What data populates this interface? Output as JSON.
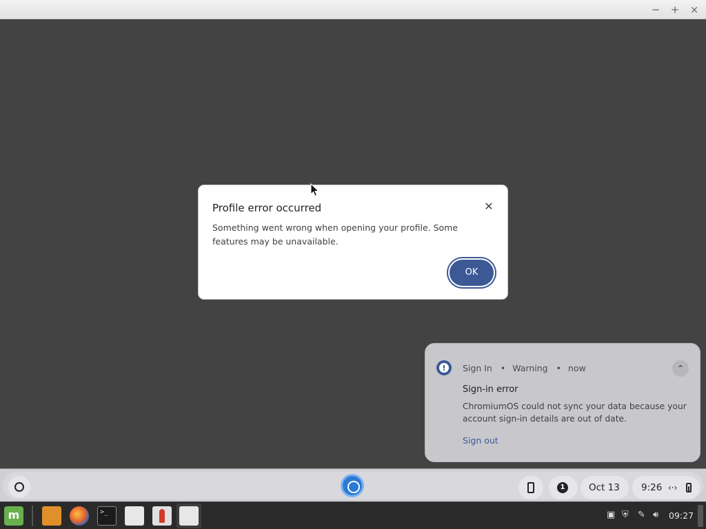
{
  "window": {
    "minimize_glyph": "−",
    "maximize_glyph": "+",
    "close_glyph": "×"
  },
  "dialog": {
    "title": "Profile error occurred",
    "message": "Something went wrong when opening your profile. Some features may be unavailable.",
    "ok_label": "OK",
    "close_glyph": "✕"
  },
  "notification": {
    "source": "Sign In",
    "severity": "Warning",
    "time": "now",
    "separator": "•",
    "title": "Sign-in error",
    "body": "ChromiumOS could not sync your data because your account sign-in details are out of date.",
    "action_label": "Sign out",
    "collapse_glyph": "⌃",
    "icon": "warning-icon"
  },
  "shelf": {
    "notification_count": "1",
    "date": "Oct 13",
    "time": "9:26",
    "network_glyph": "‹·›",
    "icons": [
      "launcher-icon",
      "chrome-icon",
      "phone-hub-icon",
      "battery-icon"
    ]
  },
  "taskbar": {
    "apps": [
      "mint-menu-icon",
      "files-icon",
      "firefox-icon",
      "terminal-icon",
      "app-icon",
      "rocket-icon",
      "app-icon"
    ],
    "tray_icons": [
      "clipboard-icon",
      "shield-icon",
      "pen-icon",
      "volume-icon"
    ],
    "clock": "09:27"
  },
  "colors": {
    "accent": "#3c5996",
    "desktop": "#434343",
    "notification_bg": "#c8c8cc",
    "taskbar_bg": "#2a2a2a"
  }
}
